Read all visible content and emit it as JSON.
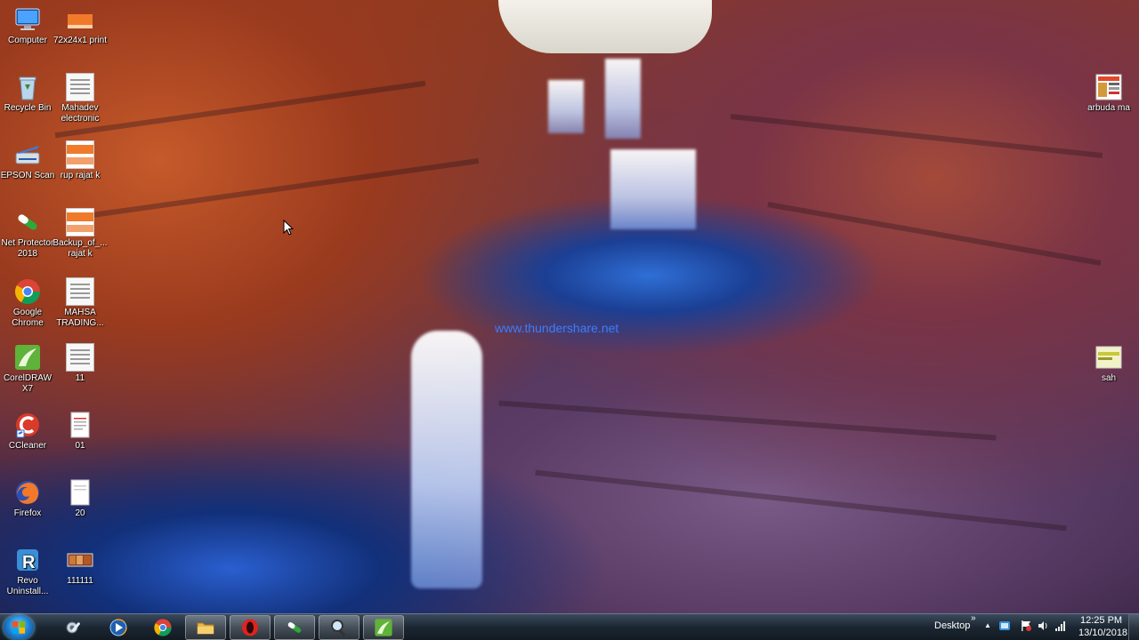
{
  "desktop": {
    "watermark": "www.thundershare.net",
    "icons": [
      {
        "label": "Computer"
      },
      {
        "label": "72x24x1 print"
      },
      {
        "label": "Recycle Bin"
      },
      {
        "label": "Mahadev electronic"
      },
      {
        "label": "EPSON Scan"
      },
      {
        "label": "rup rajat k"
      },
      {
        "label": "Net Protector 2018"
      },
      {
        "label": "Backup_of_... rajat k"
      },
      {
        "label": "Google Chrome"
      },
      {
        "label": "MAHSA TRADING..."
      },
      {
        "label": "CorelDRAW X7"
      },
      {
        "label": "11"
      },
      {
        "label": "CCleaner"
      },
      {
        "label": "01"
      },
      {
        "label": "Firefox"
      },
      {
        "label": "20"
      },
      {
        "label": "Revo Uninstall..."
      },
      {
        "label": "111111"
      },
      {
        "label": "arbuda ma"
      },
      {
        "label": "sah"
      }
    ]
  },
  "taskbar": {
    "toolbar_label": "Desktop",
    "toolbar_chevron": "»",
    "tray_expand": "▲",
    "clock": {
      "time": "12:25 PM",
      "date": "13/10/2018"
    },
    "buttons": [
      {
        "icon": "settings-wrench-icon"
      },
      {
        "icon": "media-player-icon"
      },
      {
        "icon": "chrome-icon"
      },
      {
        "icon": "folder-icon"
      },
      {
        "icon": "opera-icon"
      },
      {
        "icon": "net-protector-icon"
      },
      {
        "icon": "magnifier-icon"
      },
      {
        "icon": "coreldraw-icon"
      }
    ]
  }
}
